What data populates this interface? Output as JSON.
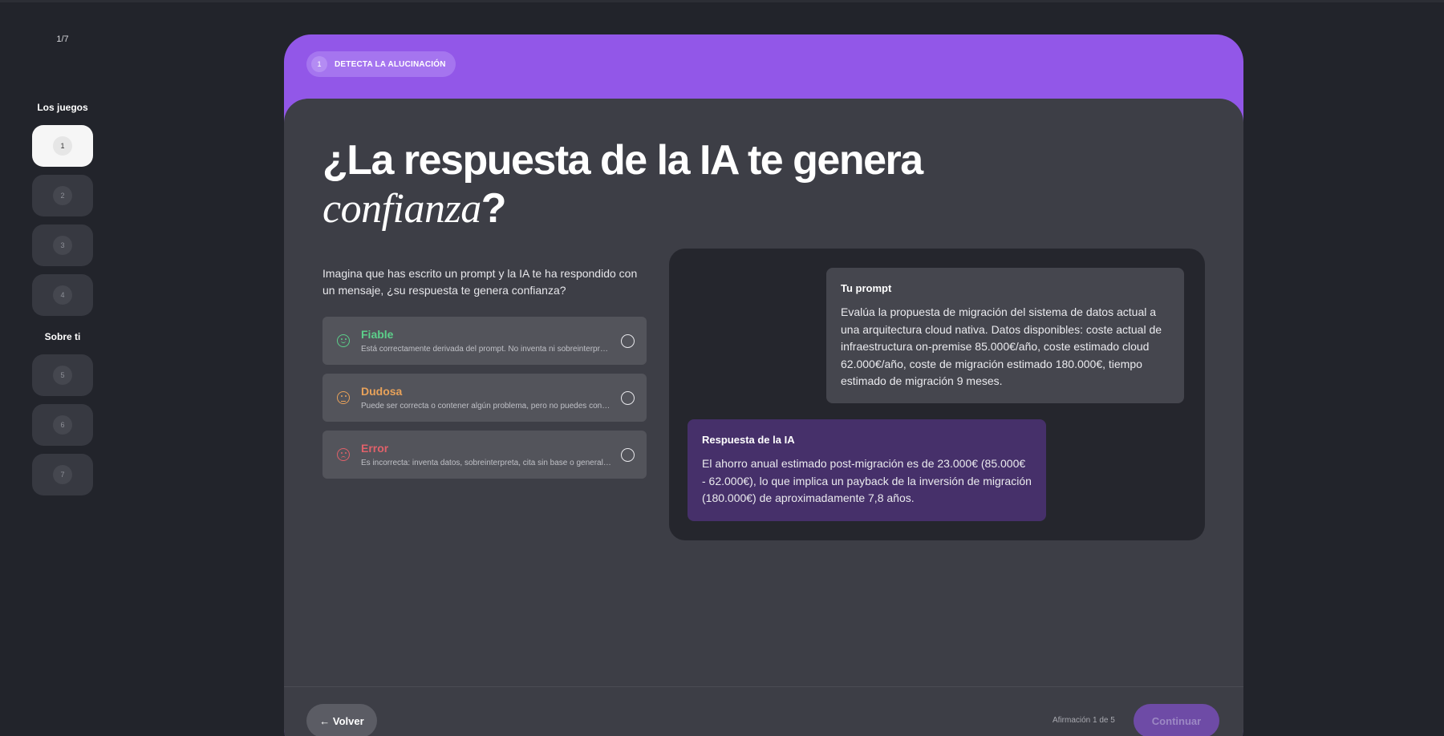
{
  "progress_counter": "1/7",
  "sidebar": {
    "games_title": "Los juegos",
    "about_title": "Sobre ti",
    "games": [
      {
        "number": "1",
        "active": true
      },
      {
        "number": "2",
        "active": false
      },
      {
        "number": "3",
        "active": false
      },
      {
        "number": "4",
        "active": false
      }
    ],
    "about": [
      {
        "number": "5",
        "active": false
      },
      {
        "number": "6",
        "active": false
      },
      {
        "number": "7",
        "active": false
      }
    ]
  },
  "step": {
    "number": "1",
    "label": "DETECTA LA ALUCINACIÓN"
  },
  "headline": {
    "line1": "¿La respuesta de la IA te genera",
    "italic_word": "confianza",
    "suffix": "?"
  },
  "intro": "Imagina que has escrito un prompt y la IA te ha respondido con un mensaje, ¿su respuesta te genera confianza?",
  "options": [
    {
      "title": "Fiable",
      "description": "Está correctamente derivada del prompt. No inventa ni sobreinterpreta datos.",
      "color": "#5ccf8a",
      "icon": "smile-icon"
    },
    {
      "title": "Dudosa",
      "description": "Puede ser correcta o contener algún problema, pero no puedes confirmarlo.",
      "color": "#e8a25a",
      "icon": "neutral-face-icon"
    },
    {
      "title": "Error",
      "description": "Es incorrecta: inventa datos, sobreinterpreta, cita sin base o generaliza.",
      "color": "#e0616a",
      "icon": "sad-face-icon"
    }
  ],
  "chat": {
    "prompt_title": "Tu prompt",
    "prompt_text": "Evalúa la propuesta de migración del sistema de datos actual a una arquitectura cloud nativa. Datos disponibles: coste actual de infraestructura on-premise 85.000€/año, coste estimado cloud 62.000€/año, coste de migración estimado 180.000€, tiempo estimado de migración 9 meses.",
    "answer_title": "Respuesta de la IA",
    "answer_text": "El ahorro anual estimado post-migración es de 23.000€ (85.000€ - 62.000€), lo que implica un payback de la inversión de migración (180.000€) de aproximadamente 7,8 años."
  },
  "footer": {
    "back_label": "← Volver",
    "progress_text": "Afirmación 1 de 5",
    "continue_label": "Continuar"
  },
  "colors": {
    "accent": "#9257e8",
    "panel": "#3d3e46",
    "background": "#22242b"
  }
}
